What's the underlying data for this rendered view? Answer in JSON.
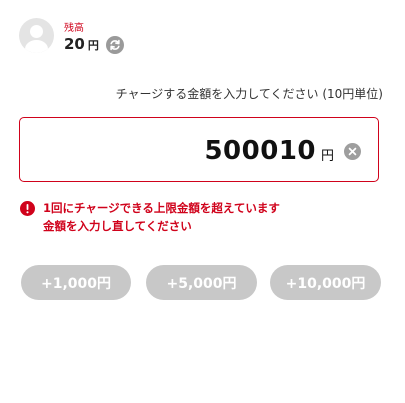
{
  "balance": {
    "label": "残高",
    "amount": "20",
    "currency": "円"
  },
  "instruction": "チャージする金額を入力してください (10円単位)",
  "input": {
    "value": "500010",
    "currency": "円"
  },
  "error": {
    "line1": "1回にチャージできる上限金額を超えています",
    "line2": "金額を入力し直してください"
  },
  "presets": [
    "+1,000円",
    "+5,000円",
    "+10,000円"
  ],
  "colors": {
    "error": "#d0021b",
    "preset_bg": "#c8c8c8"
  },
  "icons": {
    "avatar": "user-avatar-icon",
    "refresh": "refresh-icon",
    "clear": "clear-icon",
    "error": "error-icon"
  }
}
